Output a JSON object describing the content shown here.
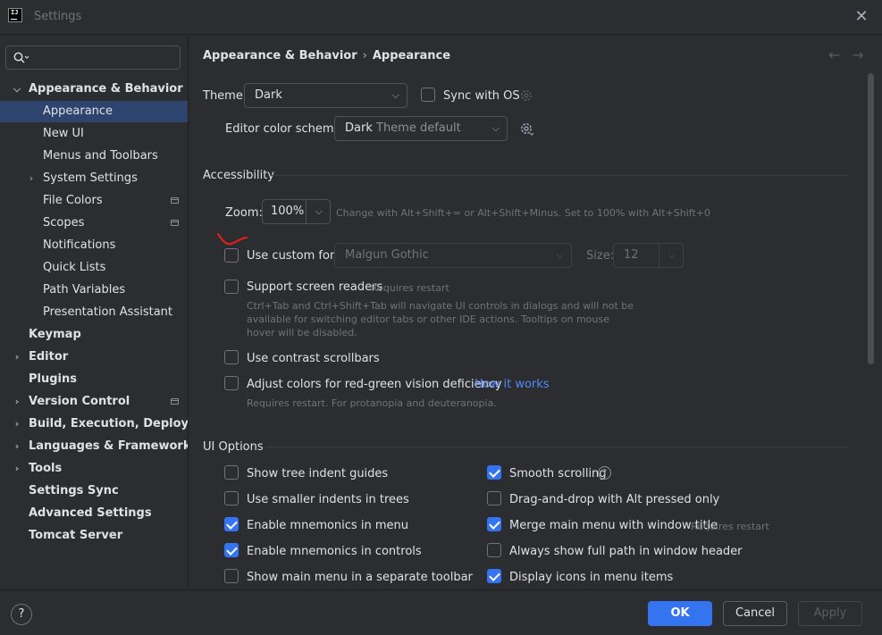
{
  "window": {
    "title": "Settings",
    "logo_text": "IJ"
  },
  "sidebar": {
    "search_placeholder": "",
    "items": [
      {
        "label": "Appearance & Behavior",
        "level": 0,
        "expanded": true
      },
      {
        "label": "Appearance",
        "level": 1,
        "selected": true
      },
      {
        "label": "New UI",
        "level": 1
      },
      {
        "label": "Menus and Toolbars",
        "level": 1
      },
      {
        "label": "System Settings",
        "level": 1,
        "expandable": true
      },
      {
        "label": "File Colors",
        "level": 1,
        "badge": true
      },
      {
        "label": "Scopes",
        "level": 1,
        "badge": true
      },
      {
        "label": "Notifications",
        "level": 1
      },
      {
        "label": "Quick Lists",
        "level": 1
      },
      {
        "label": "Path Variables",
        "level": 1
      },
      {
        "label": "Presentation Assistant",
        "level": 1
      },
      {
        "label": "Keymap",
        "level": 0
      },
      {
        "label": "Editor",
        "level": 0,
        "expandable": true
      },
      {
        "label": "Plugins",
        "level": 0
      },
      {
        "label": "Version Control",
        "level": 0,
        "expandable": true,
        "badge": true
      },
      {
        "label": "Build, Execution, Deployment",
        "level": 0,
        "expandable": true
      },
      {
        "label": "Languages & Frameworks",
        "level": 0,
        "expandable": true
      },
      {
        "label": "Tools",
        "level": 0,
        "expandable": true
      },
      {
        "label": "Settings Sync",
        "level": 0
      },
      {
        "label": "Advanced Settings",
        "level": 0
      },
      {
        "label": "Tomcat Server",
        "level": 0
      }
    ]
  },
  "breadcrumb": {
    "parent": "Appearance & Behavior",
    "separator": "›",
    "current": "Appearance"
  },
  "theme": {
    "label": "Theme:",
    "value": "Dark",
    "sync_label": "Sync with OS",
    "sync_checked": false
  },
  "editor_scheme": {
    "label": "Editor color scheme:",
    "value": "Dark",
    "value_suffix": "Theme default"
  },
  "accessibility": {
    "title": "Accessibility",
    "zoom_label": "Zoom:",
    "zoom_value": "100%",
    "zoom_hint": "Change with Alt+Shift+= or Alt+Shift+Minus. Set to 100% with Alt+Shift+0",
    "custom_font_label": "Use custom font:",
    "custom_font_checked": false,
    "font_value": "Malgun Gothic",
    "size_label": "Size:",
    "size_value": "12",
    "screen_readers_label": "Support screen readers",
    "screen_readers_checked": false,
    "screen_readers_hint": "Requires restart",
    "screen_readers_desc": [
      "Ctrl+Tab and Ctrl+Shift+Tab will navigate UI controls in dialogs and will not be",
      "available for switching editor tabs or other IDE actions. Tooltips on mouse",
      "hover will be disabled."
    ],
    "contrast_label": "Use contrast scrollbars",
    "contrast_checked": false,
    "color_def_label": "Adjust colors for red-green vision deficiency",
    "color_def_checked": false,
    "how_it_works": "How it works",
    "color_def_hint": "Requires restart. For protanopia and deuteranopia."
  },
  "ui_options": {
    "title": "UI Options",
    "left": [
      {
        "label": "Show tree indent guides",
        "checked": false
      },
      {
        "label": "Use smaller indents in trees",
        "checked": false
      },
      {
        "label": "Enable mnemonics in menu",
        "checked": true
      },
      {
        "label": "Enable mnemonics in controls",
        "checked": true
      },
      {
        "label": "Show main menu in a separate toolbar",
        "checked": false
      }
    ],
    "right": [
      {
        "label": "Smooth scrolling",
        "checked": true
      },
      {
        "label": "Drag-and-drop with Alt pressed only",
        "checked": false
      },
      {
        "label": "Merge main menu with window title",
        "checked": true,
        "hint": "Requires restart"
      },
      {
        "label": "Always show full path in window header",
        "checked": false
      },
      {
        "label": "Display icons in menu items",
        "checked": true
      }
    ]
  },
  "footer": {
    "help": "?",
    "ok": "OK",
    "cancel": "Cancel",
    "apply": "Apply"
  },
  "colors": {
    "accent": "#3574f0",
    "selection": "#2e436e",
    "link": "#548af7",
    "annotation": "#e0201a"
  }
}
